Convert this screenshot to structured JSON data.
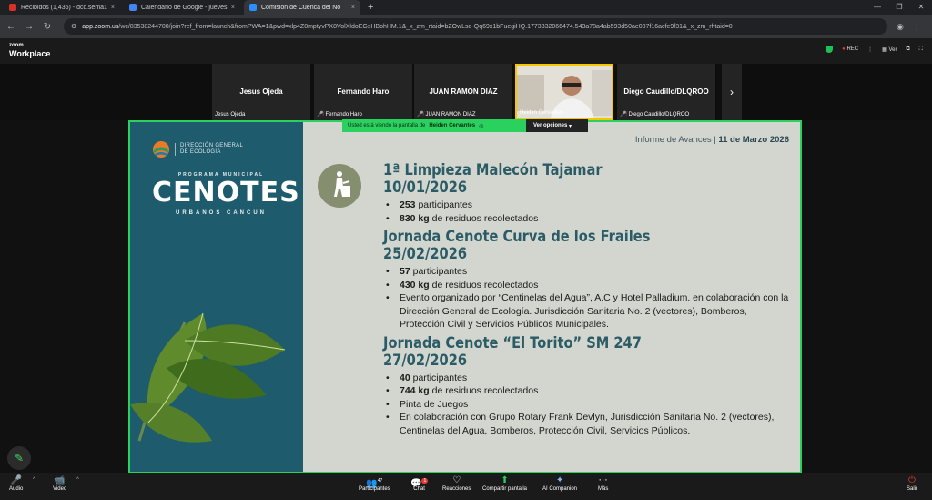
{
  "browser": {
    "tabs": [
      {
        "title": "Recibidos (1,435) - dcc.sema14@",
        "color": "#d93025"
      },
      {
        "title": "Calendario de Google - jueves,",
        "color": "#4285f4"
      },
      {
        "title": "Comisión de Cuenca del No",
        "color": "#2d8cff"
      }
    ],
    "url_host": "app.zoom.us",
    "url_rest": "/wc/83538244700/join?ref_from=launch&fromPWA=1&pwd=xlp4Z8mptyvPX8VolXldoEGsHBohHM.1&_x_zm_rtaid=bZOwLso-Qq69x1bFuegiHQ.1773332066474.543a78a4ab593d50ae087f16acfe9f31&_x_zm_rhtaid=0"
  },
  "zoom": {
    "logo_top": "zoom",
    "logo_bottom": "Workplace",
    "rec": "REC",
    "view": "Ver"
  },
  "participants": [
    {
      "name": "Jesus Ojeda",
      "label": "Jesus Ojeda",
      "muted": false
    },
    {
      "name": "Fernando Haro",
      "label": "Fernando Haro",
      "muted": true
    },
    {
      "name": "JUAN RAMON DIAZ",
      "label": "JUAN RAMON DIAZ",
      "muted": true
    },
    {
      "name": "",
      "label": "Heiden Cervantes",
      "muted": false
    },
    {
      "name": "Diego Caudillo/DLQROO",
      "label": "Diego Caudillo/DLQROO",
      "muted": true
    }
  ],
  "share": {
    "viewing_prefix": "Usted está viendo la pantalla de",
    "presenter": "Heiden Cervantes",
    "options": "Ver opciones"
  },
  "slide": {
    "org_line1": "DIRECCIÓN GENERAL",
    "org_line2": "DE ECOLOGÍA",
    "program": "PROGRAMA MUNICIPAL",
    "brand": "CENOTES",
    "brand_sub": "URBANOS CANCÚN",
    "report": "Informe de Avances",
    "date": "11 de Marzo 2026",
    "events": [
      {
        "title": "1ª Limpieza Malecón Tajamar",
        "date": "10/01/2026",
        "bullets": [
          {
            "bold": "253",
            "text": " participantes"
          },
          {
            "bold": "830 kg",
            "text": " de residuos recolectados"
          }
        ]
      },
      {
        "title": "Jornada Cenote Curva de los Frailes",
        "date": "25/02/2026",
        "bullets": [
          {
            "bold": "57",
            "text": " participantes"
          },
          {
            "bold": "430 kg",
            "text": " de residuos recolectados"
          },
          {
            "bold": "",
            "text": "Evento organizado por “Centinelas del Agua”, A.C y Hotel Palladium. en colaboración con la Dirección General de Ecología. Jurisdicción Sanitaria No. 2 (vectores), Bomberos, Protección Civil y Servicios Públicos Municipales."
          }
        ]
      },
      {
        "title": "Jornada Cenote “El Torito” SM 247",
        "date": "27/02/2026",
        "bullets": [
          {
            "bold": "40",
            "text": " participantes"
          },
          {
            "bold": "744 kg",
            "text": " de residuos recolectados"
          },
          {
            "bold": "",
            "text": "Pinta de Juegos"
          },
          {
            "bold": "",
            "text": "En colaboración con Grupo Rotary Frank Devlyn, Jurisdicción Sanitaria No. 2 (vectores), Centinelas del Agua, Bomberos, Protección Civil, Servicios Públicos."
          }
        ]
      }
    ]
  },
  "toolbar": {
    "audio": "Audio",
    "video": "Video",
    "participants": "Participantes",
    "participants_count": "47",
    "chat": "Chat",
    "chat_badge": "1",
    "reactions": "Reacciones",
    "share": "Compartir pantalla",
    "ai": "AI Companion",
    "more": "Más",
    "leave": "Salir"
  }
}
